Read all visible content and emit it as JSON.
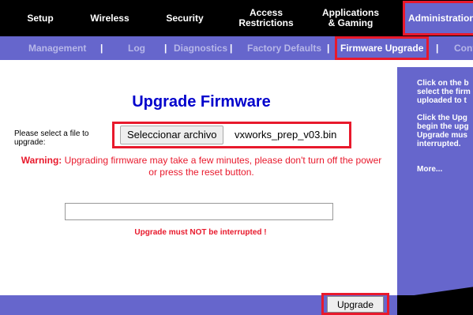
{
  "colors": {
    "accent": "#6666cc",
    "highlight": "#e8192c",
    "title": "#0000cc"
  },
  "topnav": {
    "tabs": [
      {
        "label": "Setup"
      },
      {
        "label": "Wireless"
      },
      {
        "label": "Security"
      },
      {
        "label": "Access\nRestrictions"
      },
      {
        "label": "Applications\n& Gaming"
      },
      {
        "label": "Administration"
      }
    ]
  },
  "subnav": {
    "items": [
      "Management",
      "Log",
      "Diagnostics",
      "Factory Defaults",
      "Firmware Upgrade",
      "Conf"
    ],
    "separator": "|"
  },
  "help": {
    "text": "Click on the b\nselect the firm\nuploaded to t\n\nClick the Upg\nbegin the upg\nUpgrade mus\ninterrupted.",
    "more": "More..."
  },
  "main": {
    "title": "Upgrade Firmware",
    "select_label": "Please select a file to upgrade:",
    "choose_button": "Seleccionar archivo",
    "filename": "vxworks_prep_v03.bin",
    "warning_prefix": "Warning:",
    "warning_text": " Upgrading firmware may take a few minutes, please don't turn off the power or press the reset button.",
    "not_interrupted": "Upgrade must NOT be interrupted !",
    "upgrade_button": "Upgrade"
  }
}
